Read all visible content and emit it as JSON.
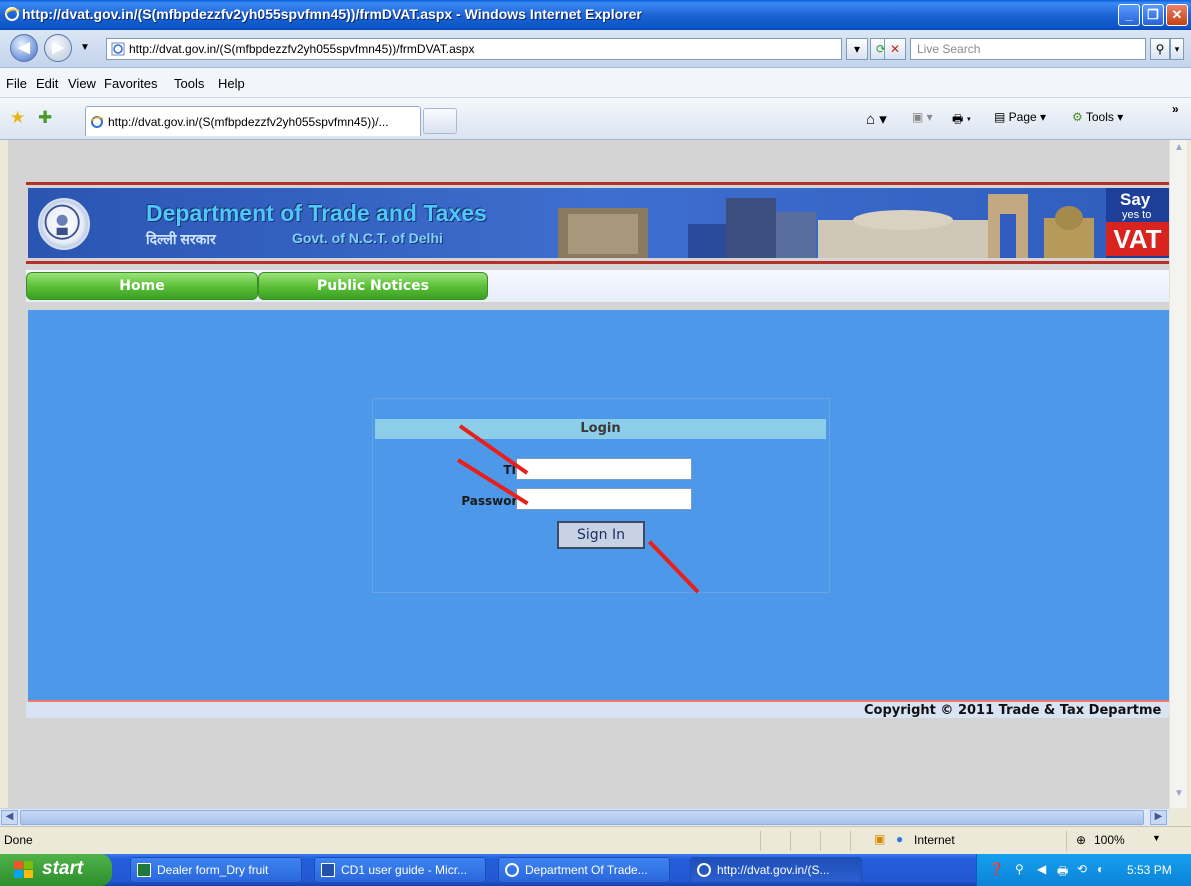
{
  "window": {
    "title": "http://dvat.gov.in/(S(mfbpdezzfv2yh055spvfmn45))/frmDVAT.aspx - Windows Internet Explorer"
  },
  "toolbar": {
    "address": "http://dvat.gov.in/(S(mfbpdezzfv2yh055spvfmn45))/frmDVAT.aspx",
    "search_placeholder": "Live Search",
    "tab_label": "http://dvat.gov.in/(S(mfbpdezzfv2yh055spvfmn45))/...",
    "page_label": "Page",
    "tools_label": "Tools"
  },
  "menu": [
    "File",
    "Edit",
    "View",
    "Favorites",
    "Tools",
    "Help"
  ],
  "site": {
    "dept_title": "Department of Trade and Taxes",
    "dept_hindi": "दिल्ली सरकार",
    "dept_govt": "Govt. of N.C.T. of Delhi",
    "say": "Say",
    "yes_to": "yes to",
    "vat": "VAT",
    "nav": [
      "Home",
      "Public Notices"
    ],
    "copyright": "Copyright © 2011 Trade & Tax Departme"
  },
  "login": {
    "heading": "Login",
    "tin_label": "TIN :",
    "password_label": "Password :",
    "tin_value": "",
    "password_value": "",
    "signin_label": "Sign In"
  },
  "status": {
    "text": "Done",
    "zone": "Internet",
    "zoom": "100%"
  },
  "taskbar": {
    "start": "start",
    "items": [
      "Dealer form_Dry fruit",
      "CD1 user guide - Micr...",
      "Department Of Trade...",
      "http://dvat.gov.in/(S..."
    ],
    "clock": "5:53 PM"
  },
  "colors": {
    "titlebar": "#0b55c9",
    "content_blue": "#4d98e8",
    "login_header": "#8ccde9",
    "nav_green": "#5dc03a",
    "annotation_arrow": "#e8201c"
  }
}
